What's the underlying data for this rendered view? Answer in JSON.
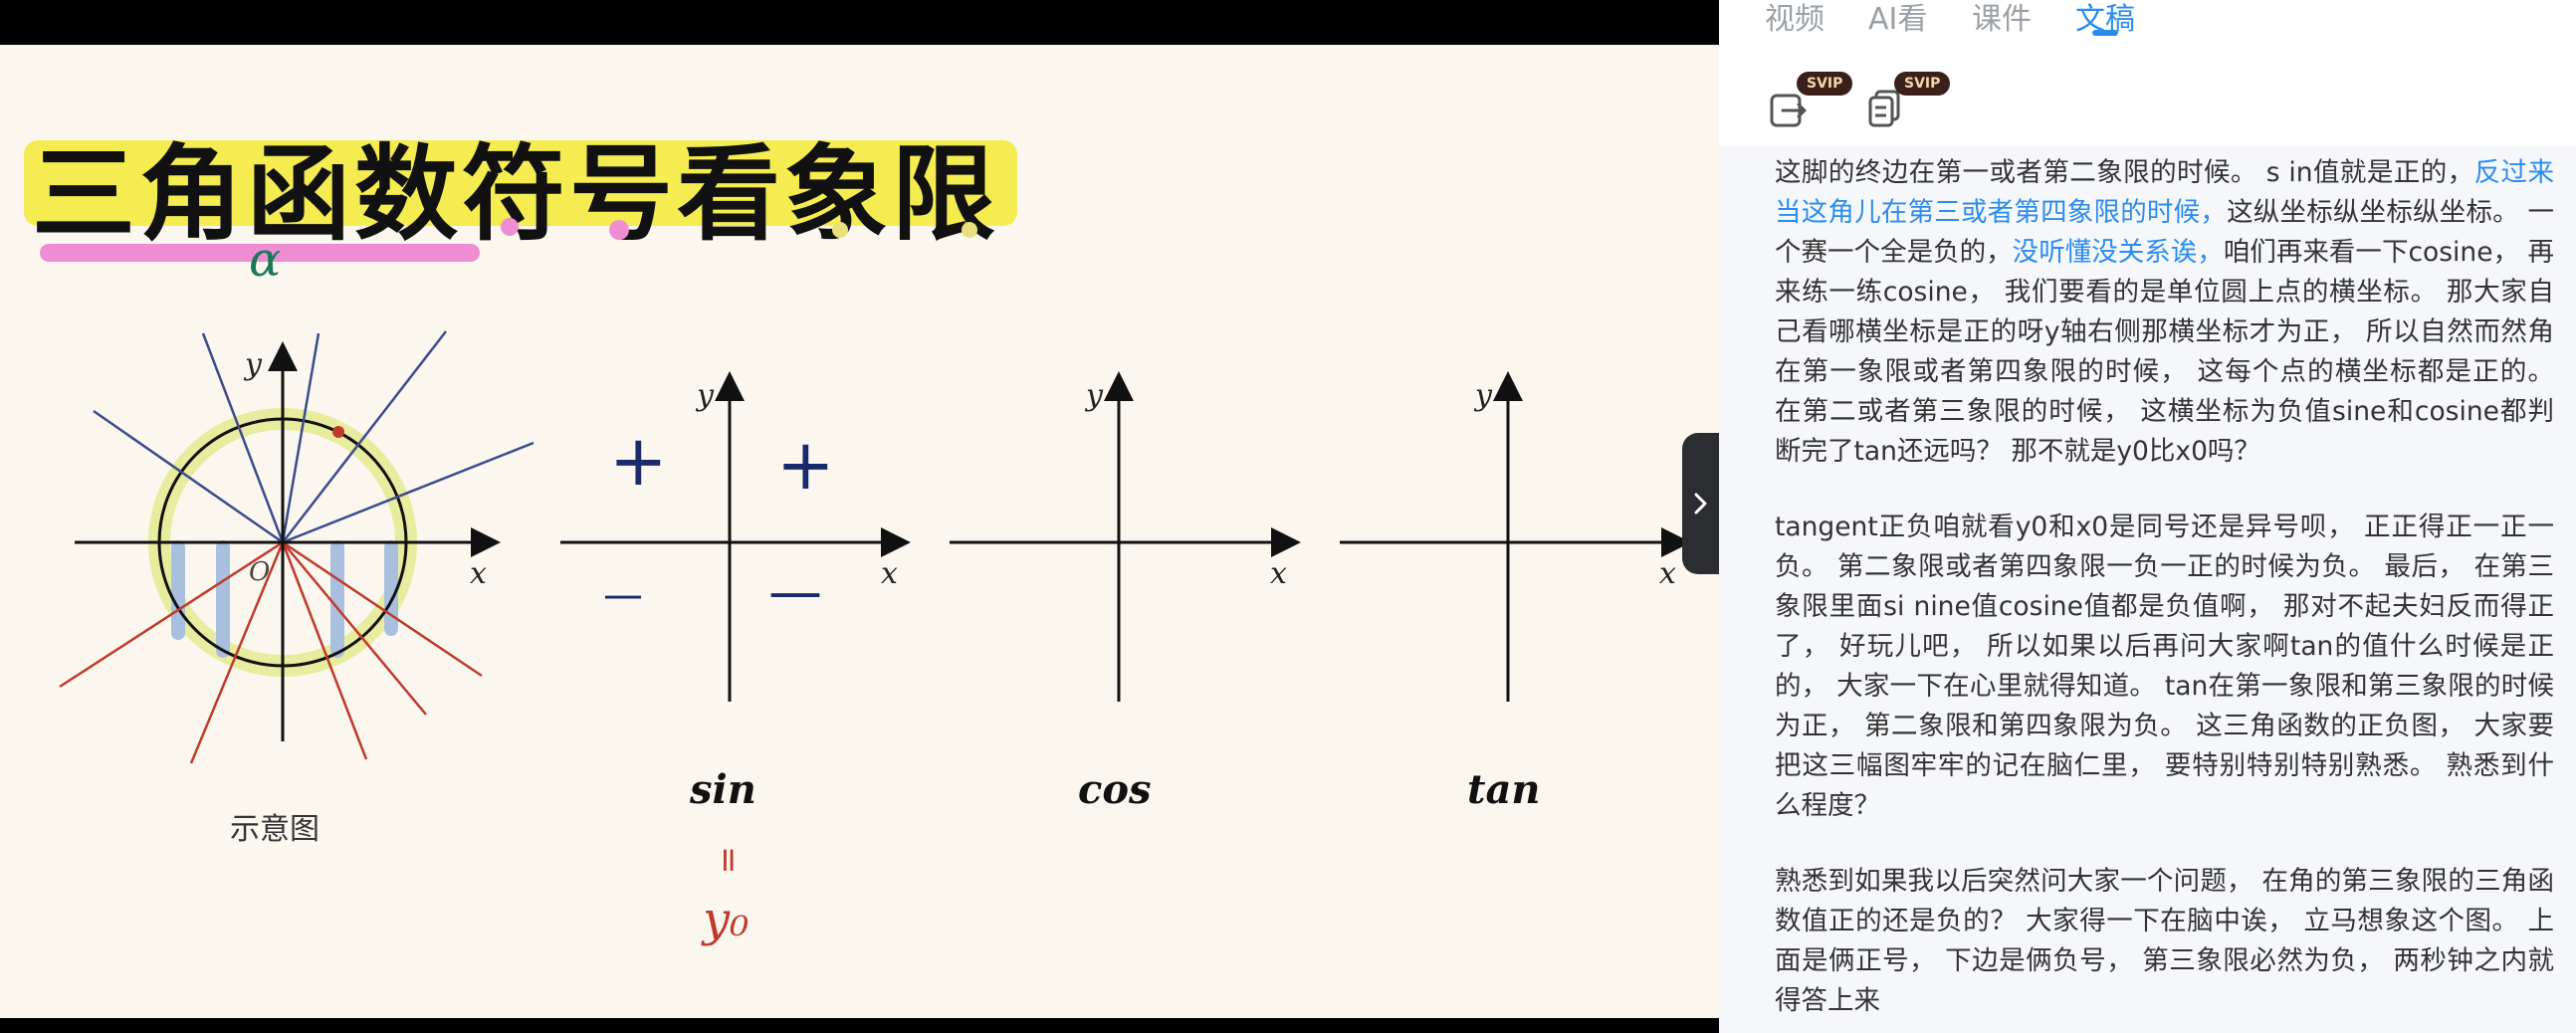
{
  "video": {
    "title": "三角函数符号看象限",
    "alpha_mark": "α",
    "caption": "示意图",
    "axis_x": "x",
    "axis_y": "y",
    "origin": "O",
    "plus": "+",
    "minus": "—",
    "functions": [
      "sin",
      "cos",
      "tan"
    ],
    "sin_annotation_eq": "=",
    "sin_annotation_y": "y₀",
    "colors": {
      "title_highlight": "#f3ea3e",
      "pink_underline": "#ef8dd3",
      "blue_lines": "#3d4a8e",
      "red_lines": "#c0392b",
      "circle_glow": "#e3e98a",
      "stripes": "#a8c0de"
    }
  },
  "panel": {
    "tabs": [
      "视频",
      "AI看",
      "课件",
      "文稿"
    ],
    "active_tab": "文稿",
    "tools": [
      {
        "icon": "export-icon",
        "badge": "SVIP"
      },
      {
        "icon": "copy-document-icon",
        "badge": "SVIP"
      }
    ],
    "collapse_icon": "chevron-right-icon",
    "transcript": {
      "p1": {
        "a": "这脚的终边在第一或者第二象限的时候。 s in值就是正的，",
        "b": "反过来当这角儿在第三或者第四象限的时候，",
        "c": "这纵坐标纵坐标纵坐标。 一个赛一个全是负的，",
        "d": "没听懂没关系诶，",
        "e": "咱们再来看一下cosine， 再来练一练cosine， 我们要看的是单位圆上点的横坐标。 那大家自己看哪横坐标是正的呀y轴右侧那横坐标才为正， 所以自然而然角在第一象限或者第四象限的时候， 这每个点的横坐标都是正的。 在第二或者第三象限的时候， 这横坐标为负值sine和cosine都判断完了tan还远吗？ 那不就是y0比x0吗？"
      },
      "p2": "tangent正负咱就看y0和x0是同号还是异号呗， 正正得正一正一负。 第二象限或者第四象限一负一正的时候为负。 最后， 在第三象限里面si nine值cosine值都是负值啊， 那对不起夫妇反而得正了， 好玩儿吧， 所以如果以后再问大家啊tan的值什么时候是正的， 大家一下在心里就得知道。 tan在第一象限和第三象限的时候为正， 第二象限和第四象限为负。 这三角函数的正负图， 大家要把这三幅图牢牢的记在脑仁里， 要特别特别特别熟悉。 熟悉到什么程度？",
      "p3": "熟悉到如果我以后突然问大家一个问题， 在角的第三象限的三角函数值正的还是负的？ 大家得一下在脑中诶， 立马想象这个图。 上面是俩正号， 下边是俩负号， 第三象限必然为负， 两秒钟之内就得答上来"
    }
  }
}
